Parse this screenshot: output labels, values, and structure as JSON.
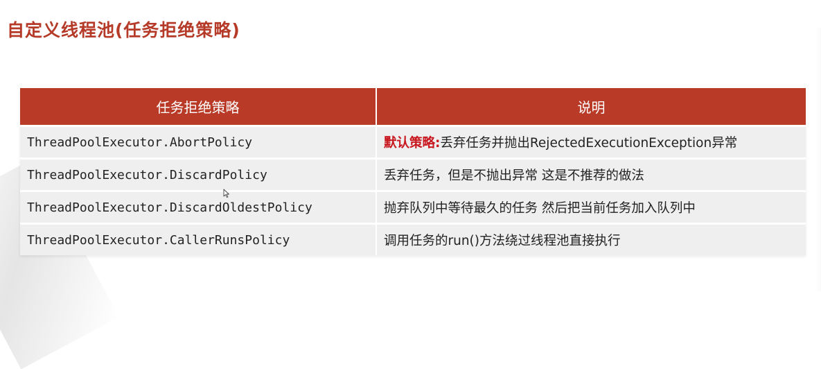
{
  "slide": {
    "title": "自定义线程池(任务拒绝策略)"
  },
  "table": {
    "headers": {
      "policy": "任务拒绝策略",
      "description": "说明"
    },
    "rows": [
      {
        "policy": "ThreadPoolExecutor.AbortPolicy",
        "description_highlight": "默认策略:",
        "description": "丢弃任务并抛出RejectedExecutionException异常"
      },
      {
        "policy": "ThreadPoolExecutor.DiscardPolicy",
        "description_highlight": "",
        "description": "丢弃任务，但是不抛出异常 这是不推荐的做法"
      },
      {
        "policy": "ThreadPoolExecutor.DiscardOldestPolicy",
        "description_highlight": "",
        "description": "抛弃队列中等待最久的任务 然后把当前任务加入队列中"
      },
      {
        "policy": "ThreadPoolExecutor.CallerRunsPolicy",
        "description_highlight": "",
        "description": "调用任务的run()方法绕过线程池直接执行"
      }
    ]
  },
  "colors": {
    "title": "#b53a27",
    "header_bg": "#b83a27",
    "row_bg": "#efefef",
    "highlight": "#c8171e"
  },
  "icons": {
    "cursor": "mouse-pointer-icon"
  }
}
